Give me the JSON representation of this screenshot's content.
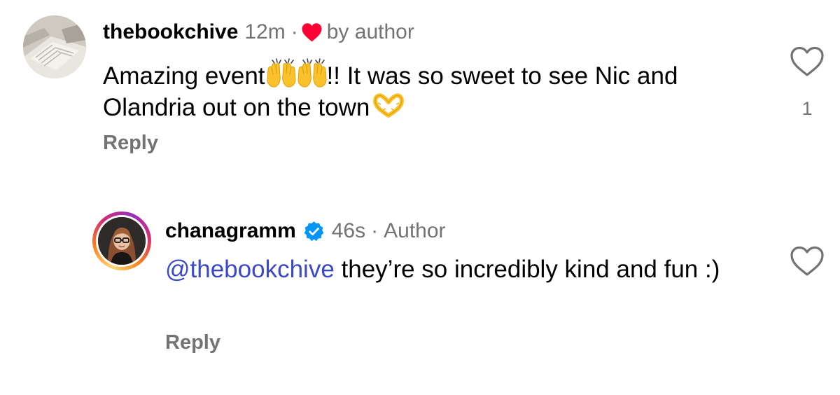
{
  "comments": [
    {
      "username": "thebookchive",
      "time": "12m",
      "separator": "·",
      "badge_text": "by author",
      "badge_icon": "heart-red-icon",
      "text_before": "Amazing event",
      "emoji_1": "raising-hands-emoji",
      "emoji_2": "raising-hands-emoji",
      "text_after": "!! It was so sweet to see Nic and Olandria out on the town",
      "emoji_3": "heart-hands-emoji",
      "reply_label": "Reply",
      "like_icon": "heart-outline-icon",
      "like_count": "1"
    },
    {
      "username": "chanagramm",
      "verified_icon": "verified-badge-icon",
      "time": "46s",
      "separator": "·",
      "author_label": "Author",
      "mention": "@thebookchive",
      "text": " they’re so incredibly kind and fun :)",
      "reply_label": "Reply",
      "like_icon": "heart-outline-icon"
    }
  ],
  "colors": {
    "heart_red": "#ff0033",
    "secondary_text": "#737373",
    "mention_blue": "#3a49c6",
    "verified_blue": "#0095f6"
  }
}
